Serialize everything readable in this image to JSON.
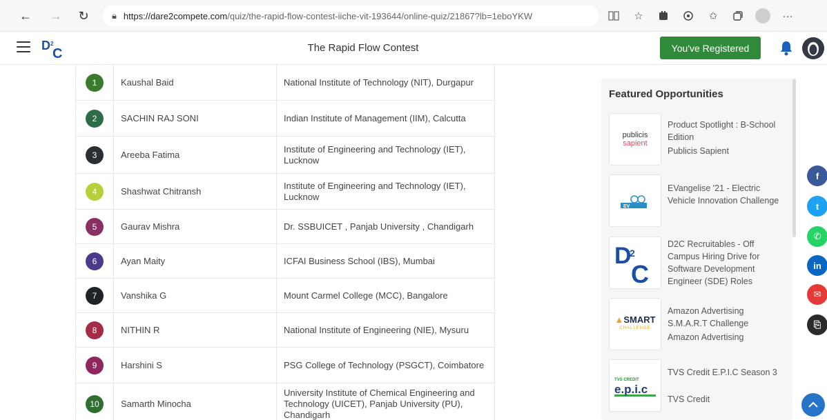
{
  "browser": {
    "url_host": "https://dare2compete.com",
    "url_path": "/quiz/the-rapid-flow-contest-iiche-vit-193644/online-quiz/21867?lb=1eboYKW",
    "icons": [
      "back-icon",
      "forward-icon",
      "refresh-icon",
      "lock-icon",
      "reader-mode-icon",
      "favorite-add-icon",
      "extension-icon",
      "ai-icon",
      "favorites-icon",
      "collections-icon",
      "profile-icon",
      "more-icon"
    ],
    "more_label": "···"
  },
  "header": {
    "logo_text": "D2C",
    "title": "The Rapid Flow Contest",
    "registered_label": "You've Registered"
  },
  "leaderboard": {
    "rows": [
      {
        "rank": "1",
        "name": "Kaushal Baid",
        "college": "National Institute of Technology (NIT), Durgapur",
        "color": "#3c7a2e"
      },
      {
        "rank": "2",
        "name": "SACHIN RAJ SONI",
        "college": "Indian Institute of Management (IIM), Calcutta",
        "color": "#2e6b47"
      },
      {
        "rank": "3",
        "name": "Areeba Fatima",
        "college": "Institute of Engineering and Technology (IET), Lucknow",
        "color": "#2a2f33"
      },
      {
        "rank": "4",
        "name": "Shashwat Chitransh",
        "college": "Institute of Engineering and Technology (IET), Lucknow",
        "color": "#b7cf3a"
      },
      {
        "rank": "5",
        "name": "Gaurav Mishra",
        "college": "Dr. SSBUICET , Panjab University , Chandigarh",
        "color": "#8a2f63"
      },
      {
        "rank": "6",
        "name": "Ayan Maity",
        "college": "ICFAI Business School (IBS), Mumbai",
        "color": "#4b3a8a"
      },
      {
        "rank": "7",
        "name": "Vanshika G",
        "college": "Mount Carmel College (MCC), Bangalore",
        "color": "#1f2326"
      },
      {
        "rank": "8",
        "name": "NITHIN R",
        "college": "National Institute of Engineering (NIE), Mysuru",
        "color": "#a52c48"
      },
      {
        "rank": "9",
        "name": "Harshini S",
        "college": "PSG College of Technology (PSGCT), Coimbatore",
        "color": "#8e2660"
      },
      {
        "rank": "10",
        "name": "Samarth Minocha",
        "college": "University Institute of Chemical Engineering and Technology (UICET), Panjab University (PU), Chandigarh",
        "color": "#2f7030"
      }
    ]
  },
  "featured": {
    "title": "Featured Opportunities",
    "cards": [
      {
        "title": "Product Spotlight : B-School Edition",
        "org": "Publicis Sapient",
        "logo_text_1": "publicis",
        "logo_text_2": "sapient"
      },
      {
        "title": "EVangelise '21 - Electric Vehicle Innovation Challenge",
        "org": "",
        "logo_text_1": "EV"
      },
      {
        "title": "D2C Recruitables - Off Campus Hiring Drive for Software Development Engineer (SDE) Roles",
        "org": "",
        "logo_text_1": "D2C"
      },
      {
        "title": "Amazon Advertising S.M.A.R.T Challenge",
        "org": "Amazon Advertising",
        "logo_text_1": "SMART",
        "logo_text_2": "CHALLENGE"
      },
      {
        "title": "TVS Credit E.P.I.C Season 3",
        "org": "TVS Credit",
        "logo_text_1": "e.p.i.c",
        "logo_text_2": "TVS CREDIT"
      }
    ]
  },
  "share": [
    {
      "name": "facebook-icon",
      "glyph": "f",
      "color": "#3b5998"
    },
    {
      "name": "twitter-icon",
      "glyph": "t",
      "color": "#1da1f2"
    },
    {
      "name": "whatsapp-icon",
      "glyph": "✆",
      "color": "#25d366"
    },
    {
      "name": "linkedin-icon",
      "glyph": "in",
      "color": "#0a66c2"
    },
    {
      "name": "email-icon",
      "glyph": "✉",
      "color": "#e53935"
    },
    {
      "name": "copy-link-icon",
      "glyph": "⎘",
      "color": "#2b2b2b"
    }
  ]
}
